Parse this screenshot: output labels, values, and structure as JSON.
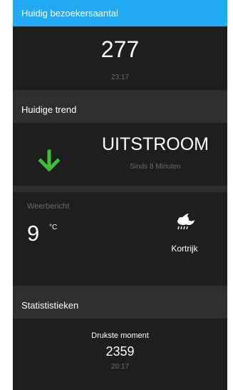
{
  "visitors": {
    "title": "Huidig bezoekersaantal",
    "count": "277",
    "time": "23:17"
  },
  "trend": {
    "title": "Huidige trend",
    "label": "UITSTROOM",
    "since": "Sinds 8 Minuten",
    "arrow_icon": "arrow-down-icon",
    "arrow_color": "#3dbd3a"
  },
  "weather": {
    "title": "Weerbericht",
    "temperature": "9",
    "unit": "°C",
    "icon": "night-rain-icon",
    "city": "Kortrijk"
  },
  "stats": {
    "title": "Statististieken",
    "busiest_label": "Drukste moment",
    "busiest_value": "2359",
    "busiest_time": "20:17"
  },
  "colors": {
    "accent": "#21a9f3",
    "background": "#1e1e1e"
  }
}
